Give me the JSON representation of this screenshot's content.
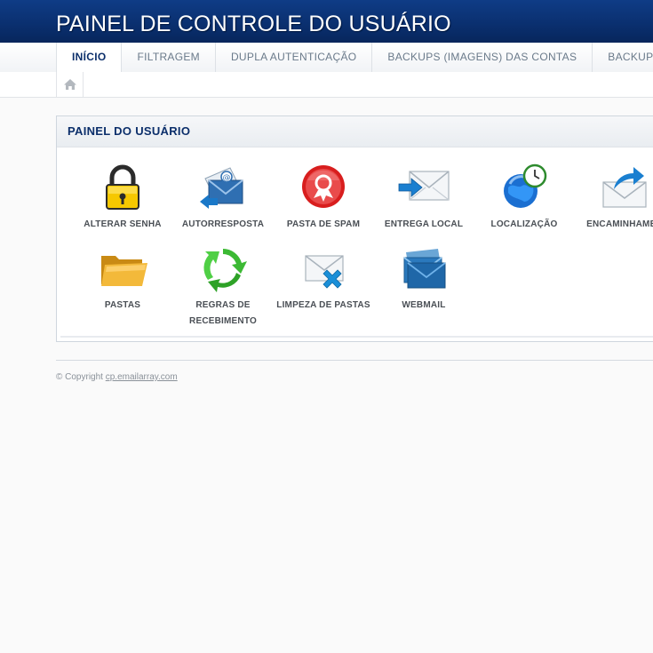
{
  "header": {
    "title": "PAINEL DE CONTROLE DO USUÁRIO"
  },
  "tabs": [
    {
      "label": "INÍCIO",
      "active": true
    },
    {
      "label": "FILTRAGEM",
      "active": false
    },
    {
      "label": "DUPLA AUTENTICAÇÃO",
      "active": false
    },
    {
      "label": "BACKUPS (IMAGENS) DAS CONTAS",
      "active": false
    },
    {
      "label": "BACKUPS DE E-",
      "active": false
    }
  ],
  "breadcrumb": {
    "home_icon": "home-icon"
  },
  "panel": {
    "title": "PAINEL DO USUÁRIO",
    "items": [
      {
        "label": "ALTERAR SENHA",
        "icon": "padlock-icon"
      },
      {
        "label": "AUTORRESPOSTA",
        "icon": "autoresponder-icon"
      },
      {
        "label": "PASTA DE SPAM",
        "icon": "spam-folder-icon"
      },
      {
        "label": "ENTREGA LOCAL",
        "icon": "local-delivery-icon"
      },
      {
        "label": "LOCALIZAÇÃO",
        "icon": "globe-clock-icon"
      },
      {
        "label": "ENCAMINHAMEN",
        "icon": "forwarding-icon"
      },
      {
        "label": "PASTAS",
        "icon": "folder-icon"
      },
      {
        "label": "REGRAS DE RECEBIMENTO",
        "icon": "recycle-icon"
      },
      {
        "label": "LIMPEZA DE PASTAS",
        "icon": "folder-cleanup-icon"
      },
      {
        "label": "WEBMAIL",
        "icon": "webmail-icon"
      }
    ]
  },
  "footer": {
    "copyright": "© Copyright",
    "link": "cp.emailarray.com"
  },
  "colors": {
    "header_bg": "#0a2f6e",
    "active_tab": "#0c2f6b",
    "accent_blue": "#1a78c8"
  }
}
